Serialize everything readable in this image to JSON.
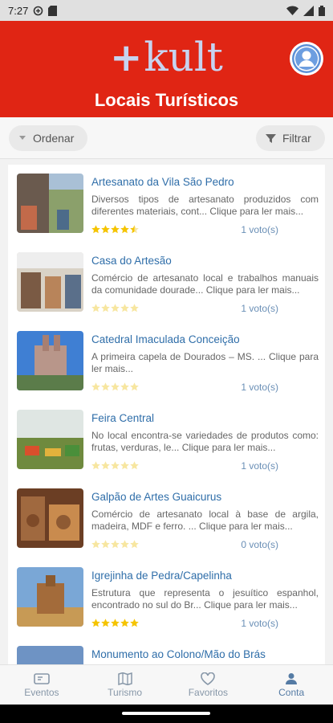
{
  "status_bar": {
    "time": "7:27"
  },
  "header": {
    "logo_plus": "+",
    "logo_text": "kult",
    "title": "Locais Turísticos"
  },
  "toolbar": {
    "order_label": "Ordenar",
    "filter_label": "Filtrar"
  },
  "items": [
    {
      "title": "Artesanato da Vila São Pedro",
      "description": "Diversos tipos de artesanato produzidos com diferentes materiais, cont... Clique para ler mais...",
      "rating": 4.5,
      "votes": "1 voto(s)"
    },
    {
      "title": "Casa do Artesão",
      "description": "Comércio de artesanato local e trabalhos manuais da comunidade dourade... Clique para ler mais...",
      "rating": 0,
      "votes": "1 voto(s)"
    },
    {
      "title": "Catedral Imaculada Conceição",
      "description": "A primeira capela de Dourados – MS. ... Clique para ler mais...",
      "rating": 0,
      "votes": "1 voto(s)"
    },
    {
      "title": "Feira Central",
      "description": "No local encontra-se variedades de produtos como: frutas, verduras, le... Clique para ler mais...",
      "rating": 0,
      "votes": "1 voto(s)"
    },
    {
      "title": "Galpão de Artes Guaicurus",
      "description": "Comércio de artesanato local à base de argila, madeira, MDF e ferro. ... Clique para ler mais...",
      "rating": 0,
      "votes": "0 voto(s)"
    },
    {
      "title": "Igrejinha de Pedra/Capelinha",
      "description": "Estrutura que representa o jesuítico espanhol, encontrado no sul do Br... Clique para ler mais...",
      "rating": 5,
      "votes": "1 voto(s)"
    },
    {
      "title": "Monumento ao Colono/Mão do Brás",
      "description": "",
      "rating": 0,
      "votes": ""
    }
  ],
  "nav": [
    {
      "label": "Eventos",
      "icon": "event-ticket-icon"
    },
    {
      "label": "Turismo",
      "icon": "map-icon"
    },
    {
      "label": "Favoritos",
      "icon": "heart-icon"
    },
    {
      "label": "Conta",
      "icon": "person-icon"
    }
  ],
  "colors": {
    "header": "#e02514",
    "link": "#2f6ea9",
    "star": "#f5c400",
    "star_empty": "#f7e6a0"
  }
}
